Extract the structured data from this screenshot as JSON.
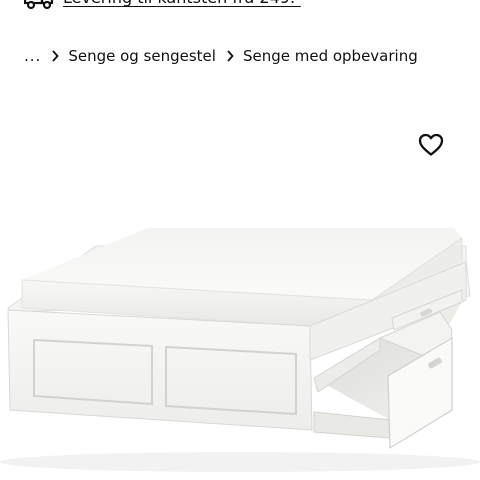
{
  "delivery": {
    "icon": "truck-icon",
    "text": "Levering til kantsten fra 249.-"
  },
  "breadcrumb": {
    "ellipsis": "...",
    "items": [
      {
        "label": "Senge og sengestel"
      },
      {
        "label": "Senge med opbevaring"
      }
    ]
  },
  "product": {
    "favorite_icon": "heart-icon",
    "image_subject": "bed-frame-with-storage"
  },
  "colors": {
    "text": "#111111",
    "background": "#ffffff",
    "product_white": "#f6f6f4"
  }
}
